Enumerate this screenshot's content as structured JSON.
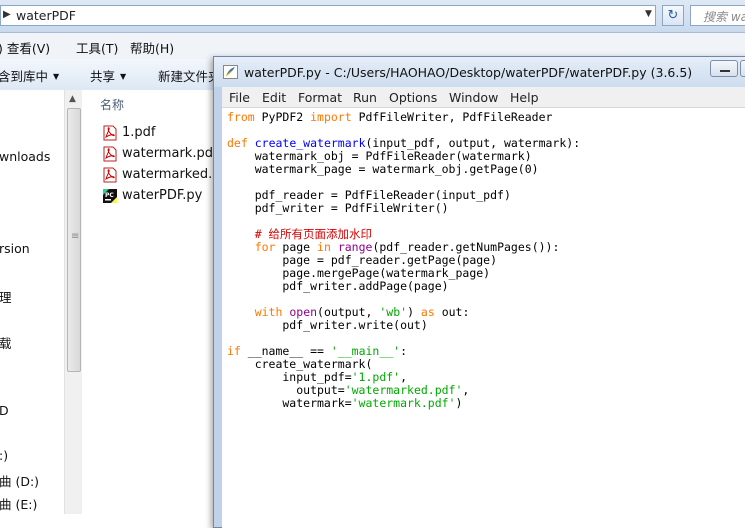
{
  "explorer": {
    "address": "waterPDF",
    "search_placeholder": "搜索 wa",
    "menu": [
      ") 查看(V)",
      "工具(T)",
      "帮助(H)"
    ],
    "toolbar": [
      "含到库中",
      "共享",
      "新建文件夹"
    ],
    "nav_items": [
      "wnloads",
      "rsion",
      "理",
      "载",
      "D",
      ":)",
      "曲 (D:)",
      "曲 (E:)"
    ],
    "column_header": "名称",
    "files": [
      {
        "name": "1.pdf",
        "icon": "pdf-icon"
      },
      {
        "name": "watermark.pdf",
        "icon": "pdf-icon"
      },
      {
        "name": "watermarked.pdf",
        "icon": "pdf-icon"
      },
      {
        "name": "waterPDF.py",
        "icon": "pycharm-icon"
      }
    ]
  },
  "idle": {
    "title": "waterPDF.py - C:/Users/HAOHAO/Desktop/waterPDF/waterPDF.py (3.6.5)",
    "menu": [
      "File",
      "Edit",
      "Format",
      "Run",
      "Options",
      "Window",
      "Help"
    ],
    "code_lines": [
      [
        [
          "kw",
          "from"
        ],
        [
          "t",
          " PyPDF2 "
        ],
        [
          "kw",
          "import"
        ],
        [
          "t",
          " PdfFileWriter, PdfFileReader"
        ]
      ],
      [],
      [
        [
          "kw",
          "def"
        ],
        [
          "t",
          " "
        ],
        [
          "fn",
          "create_watermark"
        ],
        [
          "t",
          "(input_pdf, output, watermark):"
        ]
      ],
      [
        [
          "t",
          "    watermark_obj = PdfFileReader(watermark)"
        ]
      ],
      [
        [
          "t",
          "    watermark_page = watermark_obj.getPage(0)"
        ]
      ],
      [],
      [
        [
          "t",
          "    pdf_reader = PdfFileReader(input_pdf)"
        ]
      ],
      [
        [
          "t",
          "    pdf_writer = PdfFileWriter()"
        ]
      ],
      [],
      [
        [
          "t",
          "    "
        ],
        [
          "cm",
          "# 给所有页面添加水印"
        ]
      ],
      [
        [
          "t",
          "    "
        ],
        [
          "kw",
          "for"
        ],
        [
          "t",
          " page "
        ],
        [
          "kw",
          "in"
        ],
        [
          "t",
          " "
        ],
        [
          "bi",
          "range"
        ],
        [
          "t",
          "(pdf_reader.getNumPages()):"
        ]
      ],
      [
        [
          "t",
          "        page = pdf_reader.getPage(page)"
        ]
      ],
      [
        [
          "t",
          "        page.mergePage(watermark_page)"
        ]
      ],
      [
        [
          "t",
          "        pdf_writer.addPage(page)"
        ]
      ],
      [],
      [
        [
          "t",
          "    "
        ],
        [
          "kw",
          "with"
        ],
        [
          "t",
          " "
        ],
        [
          "bi",
          "open"
        ],
        [
          "t",
          "(output, "
        ],
        [
          "st",
          "'wb'"
        ],
        [
          "t",
          ") "
        ],
        [
          "kw",
          "as"
        ],
        [
          "t",
          " out:"
        ]
      ],
      [
        [
          "t",
          "        pdf_writer.write(out)"
        ]
      ],
      [],
      [
        [
          "kw",
          "if"
        ],
        [
          "t",
          " __name__ == "
        ],
        [
          "st",
          "'__main__'"
        ],
        [
          "t",
          ":"
        ]
      ],
      [
        [
          "t",
          "    create_watermark("
        ]
      ],
      [
        [
          "t",
          "        input_pdf="
        ],
        [
          "st",
          "'1.pdf'"
        ],
        [
          "t",
          ","
        ]
      ],
      [
        [
          "t",
          "          output="
        ],
        [
          "st",
          "'watermarked.pdf'"
        ],
        [
          "t",
          ","
        ]
      ],
      [
        [
          "t",
          "        watermark="
        ],
        [
          "st",
          "'watermark.pdf'"
        ],
        [
          "t",
          ")"
        ]
      ]
    ]
  }
}
